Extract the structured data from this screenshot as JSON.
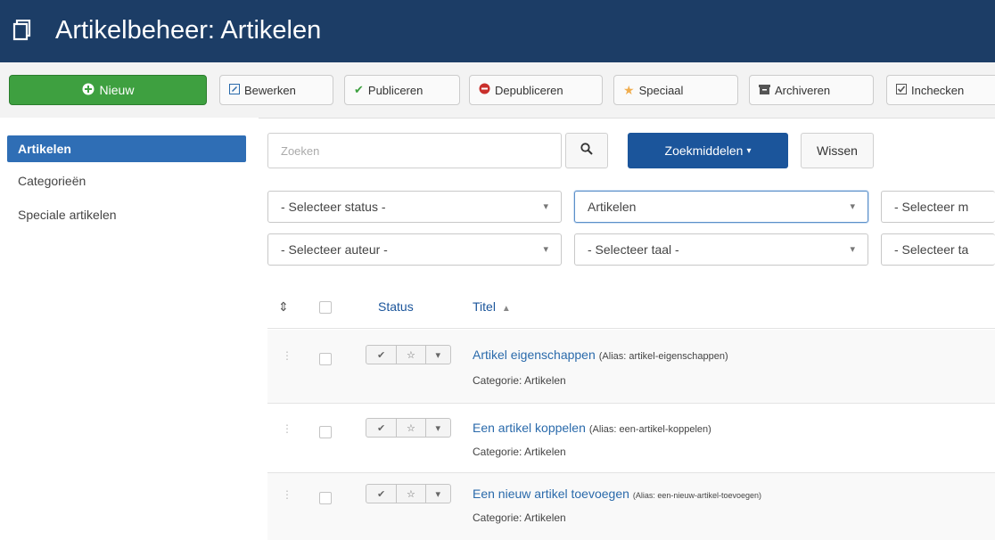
{
  "header": {
    "title": "Artikelbeheer: Artikelen"
  },
  "toolbar": {
    "new_label": "Nieuw",
    "edit_label": "Bewerken",
    "publish_label": "Publiceren",
    "unpublish_label": "Depubliceren",
    "featured_label": "Speciaal",
    "archive_label": "Archiveren",
    "checkin_label": "Inchecken"
  },
  "sidebar": {
    "items": [
      {
        "label": "Artikelen",
        "active": true
      },
      {
        "label": "Categorieën",
        "active": false
      },
      {
        "label": "Speciale artikelen",
        "active": false
      }
    ]
  },
  "search": {
    "placeholder": "Zoeken",
    "tools_label": "Zoekmiddelen",
    "clear_label": "Wissen"
  },
  "filters": {
    "status": "- Selecteer status -",
    "category": "Artikelen",
    "max_levels": "- Selecteer m",
    "author": "- Selecteer auteur -",
    "language": "- Selecteer taal -",
    "tag": "- Selecteer ta"
  },
  "table": {
    "headers": {
      "status": "Status",
      "title": "Titel"
    },
    "rows": [
      {
        "title": "Artikel eigenschappen",
        "alias": "(Alias: artikel-eigenschappen)",
        "category": "Categorie: Artikelen"
      },
      {
        "title": "Een artikel koppelen",
        "alias": "(Alias: een-artikel-koppelen)",
        "category": "Categorie: Artikelen"
      },
      {
        "title": "Een nieuw artikel toevoegen",
        "alias": "(Alias: een-nieuw-artikel-toevoegen)",
        "category": "Categorie: Artikelen"
      }
    ]
  },
  "colors": {
    "header_bg": "#1c3d66",
    "new_button": "#3ea040",
    "primary_blue": "#1b559b",
    "sidebar_active": "#2f6eb5",
    "link": "#2a6aab"
  },
  "icons": [
    "articles-icon",
    "plus-circle-icon",
    "edit-icon",
    "check-icon",
    "unpublish-icon",
    "star-icon",
    "archive-icon",
    "checkbox-icon",
    "search-icon",
    "caret-down-icon",
    "sort-icon",
    "drag-handle-icon"
  ]
}
